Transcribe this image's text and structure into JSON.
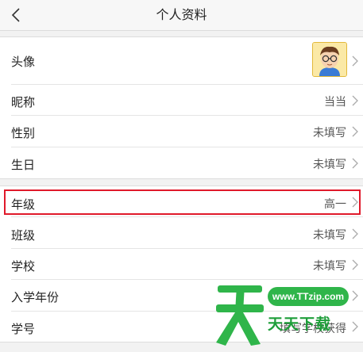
{
  "navbar": {
    "title": "个人资料",
    "back_icon": "chevron-left-icon"
  },
  "group1": {
    "avatar_label": "头像",
    "nickname_label": "昵称",
    "nickname_value": "当当",
    "gender_label": "性别",
    "gender_value": "未填写",
    "birthday_label": "生日",
    "birthday_value": "未填写"
  },
  "group2": {
    "grade_label": "年级",
    "grade_value": "高一",
    "class_label": "班级",
    "class_value": "未填写",
    "school_label": "学校",
    "school_value": "未填写",
    "enroll_year_label": "入学年份",
    "student_id_label": "学号",
    "student_id_value": "填写学校获得"
  },
  "watermark": {
    "url": "www.TTzip.com",
    "text": "天天下载"
  },
  "colors": {
    "highlight": "#e0192a",
    "watermark_green": "#2fb54a"
  }
}
